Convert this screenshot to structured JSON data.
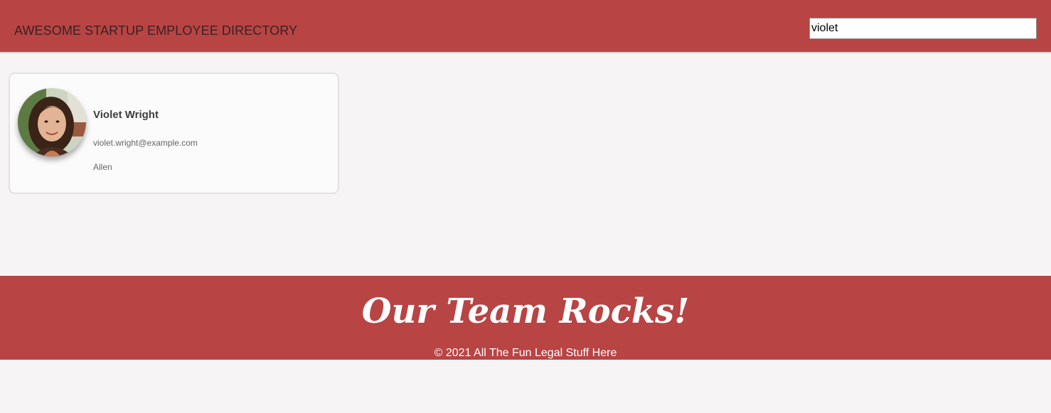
{
  "header": {
    "title": "AWESOME STARTUP EMPLOYEE DIRECTORY"
  },
  "search": {
    "value": "violet",
    "placeholder": ""
  },
  "employees": [
    {
      "name": "Violet Wright",
      "email": "violet.wright@example.com",
      "detail": "Allen",
      "avatar_icon": "person-photo"
    }
  ],
  "footer": {
    "slogan": "Our Team Rocks!",
    "legal": "© 2021 All The Fun Legal Stuff Here"
  },
  "colors": {
    "brand": "#b84444",
    "background": "#f6f4f4",
    "card": "#fbfbfb"
  }
}
